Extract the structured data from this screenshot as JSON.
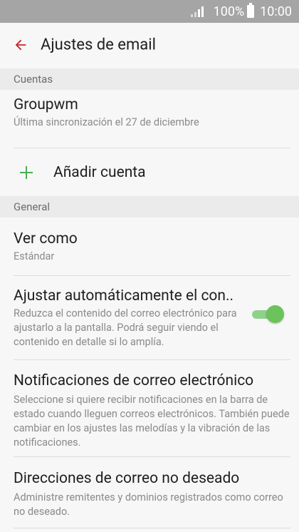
{
  "status_bar": {
    "battery": "100%",
    "time": "10:00"
  },
  "header": {
    "title": "Ajustes de email"
  },
  "sections": {
    "accounts": {
      "header": "Cuentas",
      "account": {
        "name": "Groupwm",
        "subtitle": "Última sincronización el 27 de diciembre"
      },
      "add_account": "Añadir cuenta"
    },
    "general": {
      "header": "General",
      "view_as": {
        "title": "Ver como",
        "value": "Estándar"
      },
      "auto_fit": {
        "title": "Ajustar automáticamente el con..",
        "subtitle": "Reduzca el contenido del correo electrónico para ajustarlo a la pantalla. Podrá seguir viendo el contenido en detalle si lo amplía.",
        "enabled": true
      },
      "notifications": {
        "title": "Notificaciones de correo electrónico",
        "subtitle": "Seleccione si quiere recibir notificaciones en la barra de estado cuando lleguen correos electrónicos. También puede cambiar en los ajustes las melodías y la vibración de las notificaciones."
      },
      "spam": {
        "title": "Direcciones de correo no deseado",
        "subtitle": "Administre remitentes y dominios registrados como correo no deseado."
      }
    }
  },
  "colors": {
    "accent": "#c62828",
    "toggle_on": "#6cc35c",
    "plus": "#4caf50"
  }
}
